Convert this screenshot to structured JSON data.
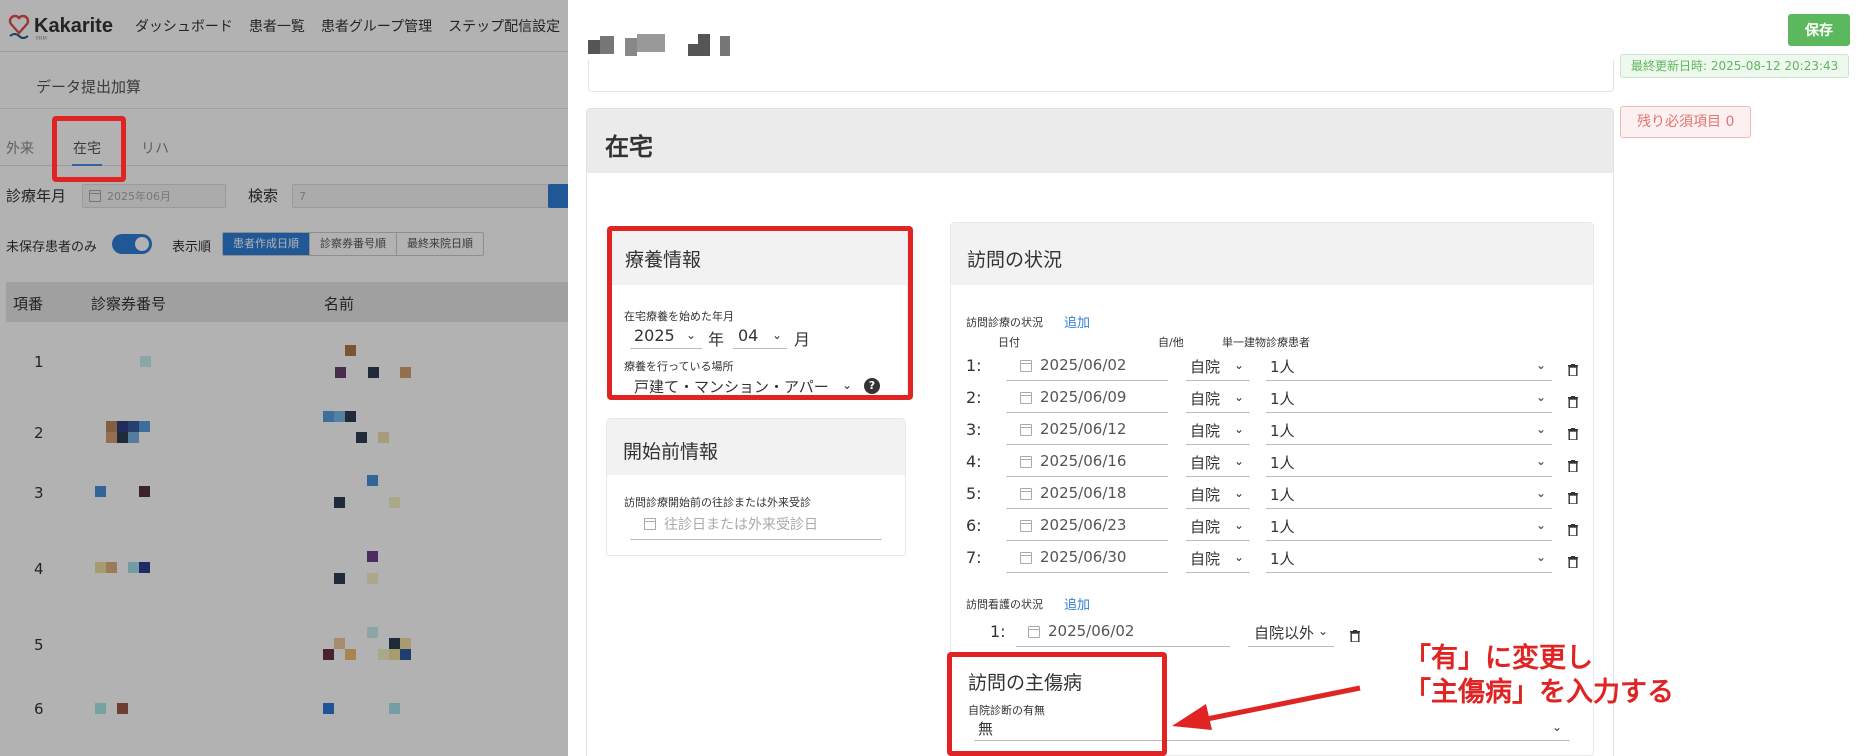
{
  "app": {
    "logo_text": "Kakarite",
    "logo_sub": "PRM",
    "nav": [
      "ダッシュボード",
      "患者一覧",
      "患者グループ管理",
      "ステップ配信設定"
    ],
    "page_title": "データ提出加算",
    "tabs": [
      "外来",
      "在宅",
      "リハ"
    ],
    "filters": {
      "month_label": "診療年月",
      "month_value": "2025年06月",
      "search_label": "検索",
      "search_value": "7",
      "unsaved_only_label": "未保存患者のみ",
      "sort_label": "表示順",
      "sort_options": [
        "患者作成日順",
        "診察券番号順",
        "最終来院日順"
      ]
    },
    "table": {
      "headers": [
        "項番",
        "診察券番号",
        "名前"
      ],
      "rows": [
        "1",
        "2",
        "3",
        "4",
        "5",
        "6"
      ]
    }
  },
  "drawer": {
    "save_label": "保存",
    "last_updated": "最終更新日時: 2025-08-12 20:23:43",
    "remaining": "残り必須項目 0",
    "section_title": "在宅",
    "care_info": {
      "title": "療養情報",
      "start_label": "在宅療養を始めた年月",
      "year": "2025",
      "year_unit": "年",
      "month": "04",
      "month_unit": "月",
      "place_label": "療養を行っている場所",
      "place_value": "戸建て・マンション・アパー",
      "help": "?"
    },
    "pre_info": {
      "title": "開始前情報",
      "label": "訪問診療開始前の往診または外来受診",
      "placeholder": "往診日または外来受診日"
    },
    "visit_status": {
      "title": "訪問の状況",
      "medical_label": "訪問診療の状況",
      "add_label": "追加",
      "col_date": "日付",
      "col_self_other": "自/他",
      "col_single": "単一建物診療患者",
      "medical_rows": [
        {
          "idx": "1:",
          "date": "2025/06/02",
          "hosp": "自院",
          "count": "1人"
        },
        {
          "idx": "2:",
          "date": "2025/06/09",
          "hosp": "自院",
          "count": "1人"
        },
        {
          "idx": "3:",
          "date": "2025/06/12",
          "hosp": "自院",
          "count": "1人"
        },
        {
          "idx": "4:",
          "date": "2025/06/16",
          "hosp": "自院",
          "count": "1人"
        },
        {
          "idx": "5:",
          "date": "2025/06/18",
          "hosp": "自院",
          "count": "1人"
        },
        {
          "idx": "6:",
          "date": "2025/06/23",
          "hosp": "自院",
          "count": "1人"
        },
        {
          "idx": "7:",
          "date": "2025/06/30",
          "hosp": "自院",
          "count": "1人"
        }
      ],
      "nursing_label": "訪問看護の状況",
      "nursing_rows": [
        {
          "idx": "1:",
          "date": "2025/06/02",
          "hosp": "自院以外"
        }
      ]
    },
    "main_injury": {
      "title": "訪問の主傷病",
      "label": "自院診断の有無",
      "value": "無"
    }
  },
  "annotation": {
    "line1": "「有」に変更し",
    "line2": "「主傷病」を入力する"
  },
  "colors": {
    "primary": "#2f7fd8",
    "save": "#5cb85c",
    "annotation_red": "#e02424"
  }
}
